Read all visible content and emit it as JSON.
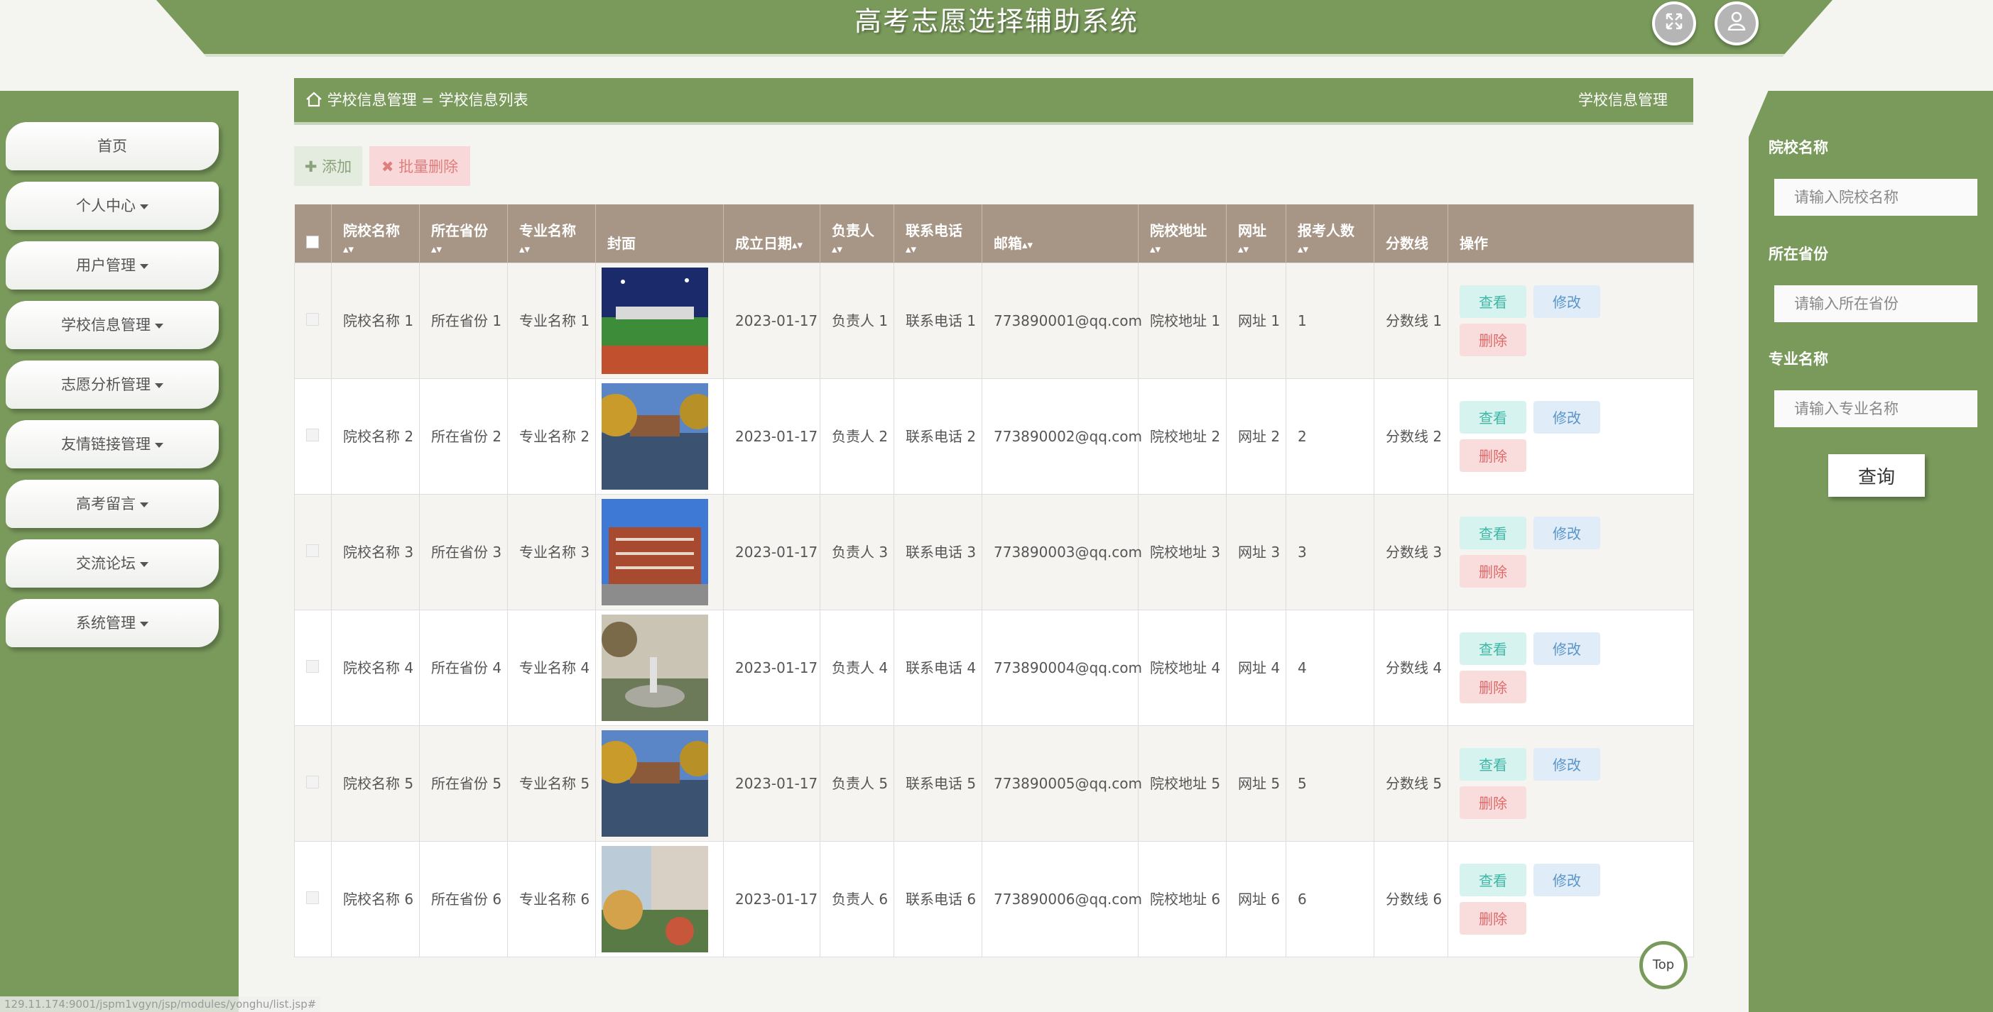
{
  "header": {
    "title": "高考志愿选择辅助系统",
    "fullscreen_icon": "expand-icon",
    "user_icon": "user-icon"
  },
  "sidebar": {
    "items": [
      {
        "label": "首页",
        "has_caret": false
      },
      {
        "label": "个人中心",
        "has_caret": true
      },
      {
        "label": "用户管理",
        "has_caret": true
      },
      {
        "label": "学校信息管理",
        "has_caret": true
      },
      {
        "label": "志愿分析管理",
        "has_caret": true
      },
      {
        "label": "友情链接管理",
        "has_caret": true
      },
      {
        "label": "高考留言",
        "has_caret": true
      },
      {
        "label": "交流论坛",
        "has_caret": true
      },
      {
        "label": "系统管理",
        "has_caret": true
      }
    ]
  },
  "breadcrumb": {
    "home": "学校信息管理",
    "sep": "=",
    "current": "学校信息列表",
    "right_title": "学校信息管理"
  },
  "toolbar": {
    "add_label": "添加",
    "batch_delete_label": "批量删除"
  },
  "search": {
    "school_label": "院校名称",
    "school_placeholder": "请输入院校名称",
    "province_label": "所在省份",
    "province_placeholder": "请输入所在省份",
    "major_label": "专业名称",
    "major_placeholder": "请输入专业名称",
    "query_label": "查询"
  },
  "table": {
    "headers": [
      "院校名称",
      "所在省份",
      "专业名称",
      "封面",
      "成立日期",
      "负责人",
      "联系电话",
      "邮箱",
      "院校地址",
      "网址",
      "报考人数",
      "分数线",
      "操作"
    ],
    "rows": [
      {
        "school": "院校名称 1",
        "province": "所在省份 1",
        "major": "专业名称 1",
        "date": "2023-01-17",
        "person": "负责人 1",
        "phone": "联系电话 1",
        "email": "773890001@qq.com",
        "address": "院校地址 1",
        "url": "网址 1",
        "count": "1",
        "score": "分数线 1"
      },
      {
        "school": "院校名称 2",
        "province": "所在省份 2",
        "major": "专业名称 2",
        "date": "2023-01-17",
        "person": "负责人 2",
        "phone": "联系电话 2",
        "email": "773890002@qq.com",
        "address": "院校地址 2",
        "url": "网址 2",
        "count": "2",
        "score": "分数线 2"
      },
      {
        "school": "院校名称 3",
        "province": "所在省份 3",
        "major": "专业名称 3",
        "date": "2023-01-17",
        "person": "负责人 3",
        "phone": "联系电话 3",
        "email": "773890003@qq.com",
        "address": "院校地址 3",
        "url": "网址 3",
        "count": "3",
        "score": "分数线 3"
      },
      {
        "school": "院校名称 4",
        "province": "所在省份 4",
        "major": "专业名称 4",
        "date": "2023-01-17",
        "person": "负责人 4",
        "phone": "联系电话 4",
        "email": "773890004@qq.com",
        "address": "院校地址 4",
        "url": "网址 4",
        "count": "4",
        "score": "分数线 4"
      },
      {
        "school": "院校名称 5",
        "province": "所在省份 5",
        "major": "专业名称 5",
        "date": "2023-01-17",
        "person": "负责人 5",
        "phone": "联系电话 5",
        "email": "773890005@qq.com",
        "address": "院校地址 5",
        "url": "网址 5",
        "count": "5",
        "score": "分数线 5"
      },
      {
        "school": "院校名称 6",
        "province": "所在省份 6",
        "major": "专业名称 6",
        "date": "2023-01-17",
        "person": "负责人 6",
        "phone": "联系电话 6",
        "email": "773890006@qq.com",
        "address": "院校地址 6",
        "url": "网址 6",
        "count": "6",
        "score": "分数线 6"
      }
    ],
    "actions": {
      "view": "查看",
      "edit": "修改",
      "delete": "删除"
    }
  },
  "top_button": "Top",
  "status_url": "129.11.174:9001/jspm1vgyn/jsp/modules/yonghu/list.jsp#"
}
